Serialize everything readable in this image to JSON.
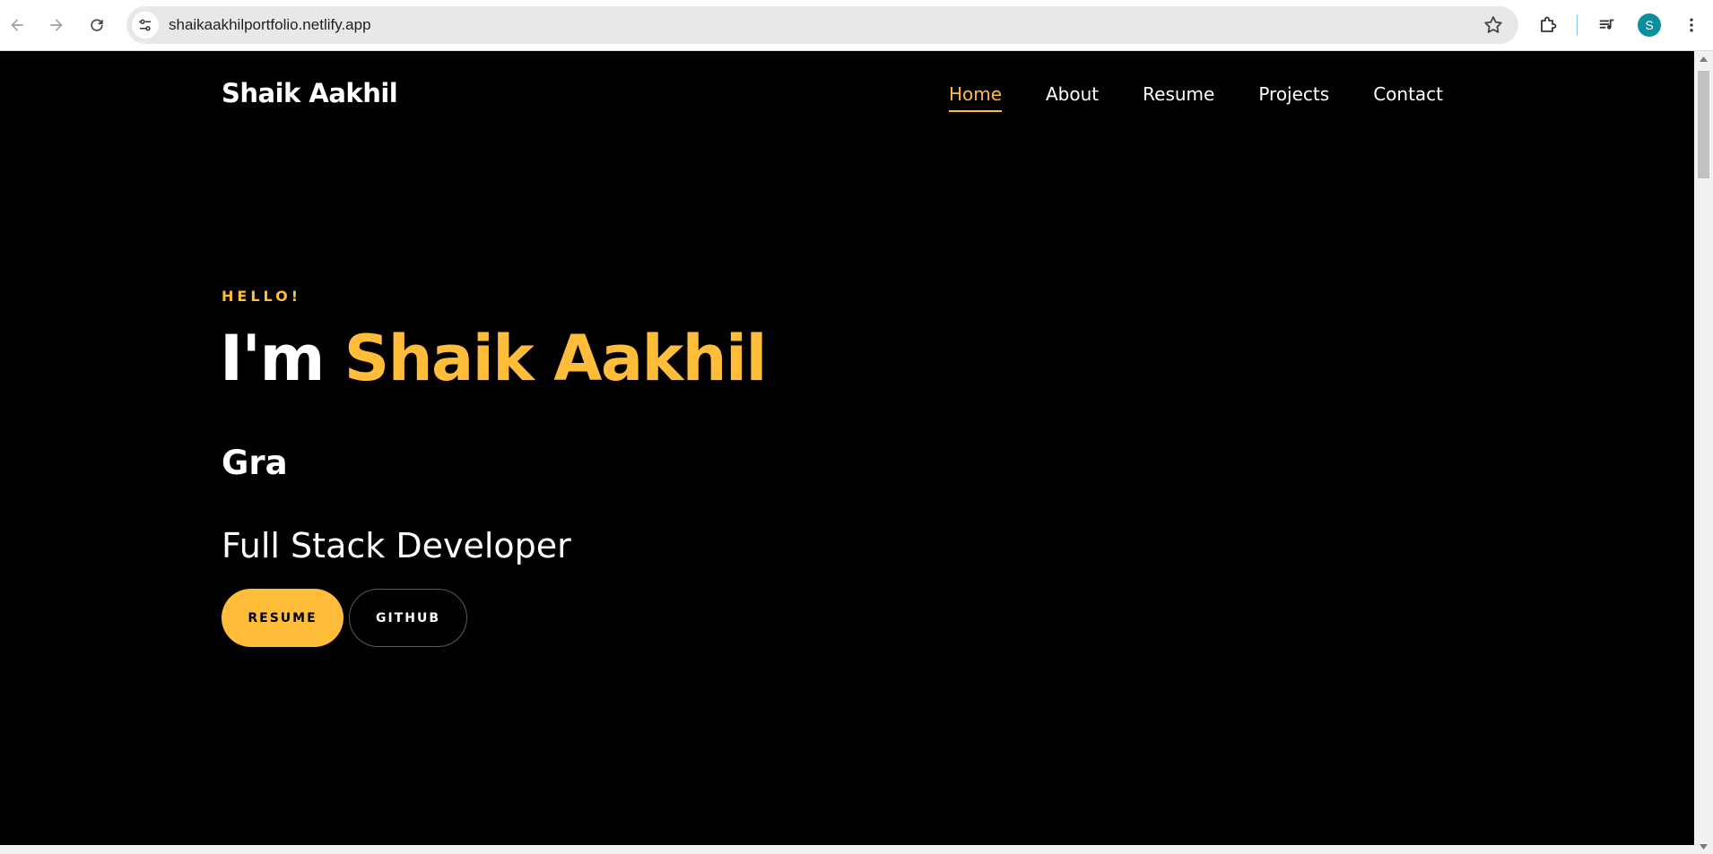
{
  "browser": {
    "url": "shaikaakhilportfolio.netlify.app",
    "profile_initial": "S",
    "icons": {
      "back": "arrow-left-icon",
      "forward": "arrow-right-icon",
      "reload": "reload-icon",
      "site_info": "tune-icon",
      "bookmark": "star-icon",
      "extensions": "puzzle-icon",
      "media": "playlist-icon",
      "menu": "more-vert-icon"
    }
  },
  "site": {
    "brand": "Shaik Aakhil",
    "nav": [
      {
        "label": "Home",
        "active": true
      },
      {
        "label": "About",
        "active": false
      },
      {
        "label": "Resume",
        "active": false
      },
      {
        "label": "Projects",
        "active": false
      },
      {
        "label": "Contact",
        "active": false
      }
    ],
    "hero": {
      "greeting": "HELLO!",
      "headline_prefix": "I'm",
      "headline_name": "Shaik Aakhil",
      "typed_text": "Gra",
      "role": "Full Stack Developer",
      "buttons": {
        "resume": "RESUME",
        "github": "GITHUB"
      }
    }
  },
  "colors": {
    "accent": "#ffbd39",
    "background": "#000000",
    "text": "#ffffff"
  }
}
